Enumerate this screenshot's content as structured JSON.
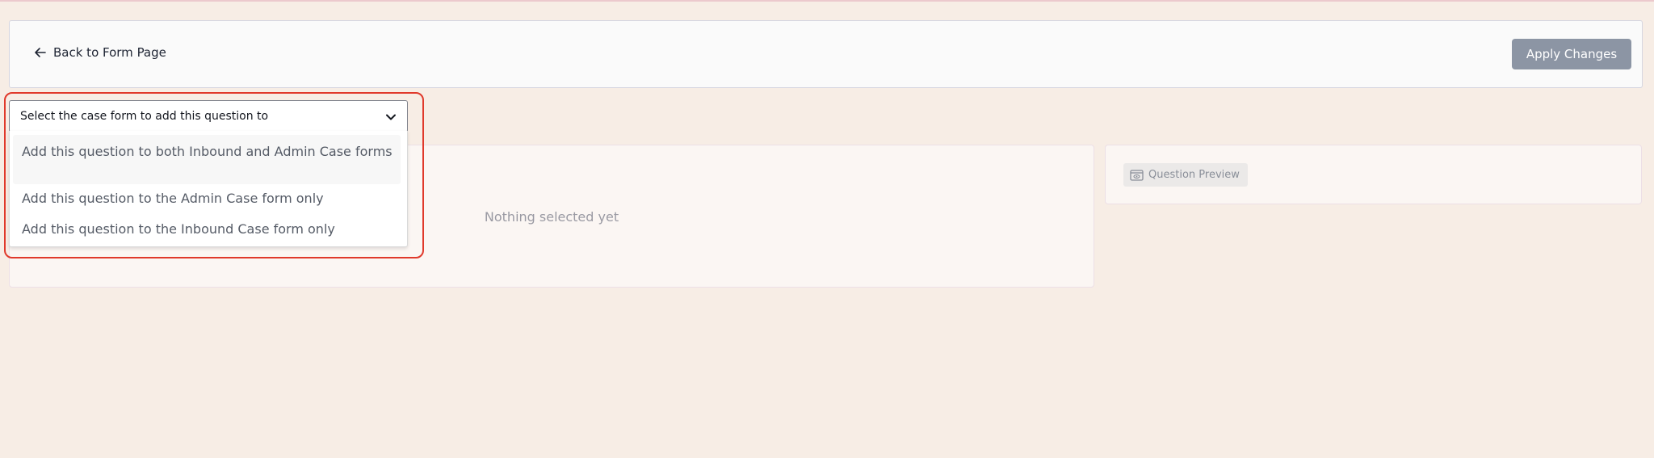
{
  "header": {
    "back_label": "Back to Form Page",
    "apply_label": "Apply Changes"
  },
  "select": {
    "label": "Select the case form to add this question to",
    "options": [
      "Add this question to both Inbound and Admin Case forms",
      "Add this question to the Admin Case form only",
      "Add this question to the Inbound Case form only"
    ]
  },
  "main": {
    "empty_text": "Nothing selected yet"
  },
  "preview": {
    "label": "Question Preview"
  },
  "icons": {
    "back": "arrow-left-icon",
    "chevron": "chevron-down-icon",
    "preview": "preview-eye-icon"
  },
  "colors": {
    "page_background": "#f7ede5",
    "apply_button": "#8c95a4",
    "highlight_outline": "#e0392b"
  }
}
